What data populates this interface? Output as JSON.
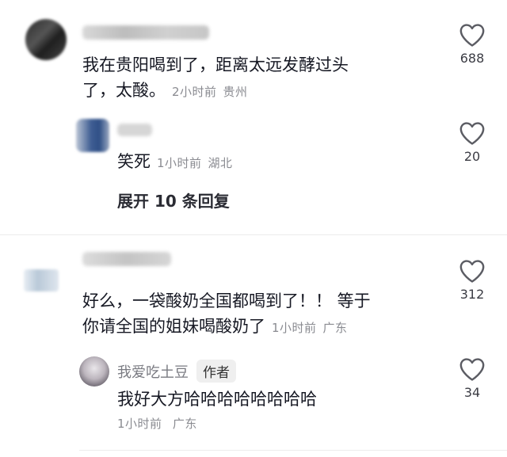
{
  "comments": [
    {
      "text_line1": "我在贵阳喝到了，距离太远发酵过头",
      "text_line2": "了，太酸。",
      "time": "2小时前",
      "location": "贵州",
      "likes": "688",
      "replies": [
        {
          "text": "笑死",
          "time": "1小时前",
          "location": "湖北",
          "likes": "20"
        }
      ],
      "expand_label": "展开 10 条回复"
    },
    {
      "text_line1": "好么，一袋酸奶全国都喝到了！！ 等于",
      "text_line2": "你请全国的姐妹喝酸奶了",
      "time": "1小时前",
      "location": "广东",
      "likes": "312",
      "replies": [
        {
          "username": "我爱吃土豆",
          "badge": "作者",
          "text": "我好大方哈哈哈哈哈哈哈哈",
          "time": "1小时前",
          "location": "广东",
          "likes": "34"
        }
      ]
    }
  ]
}
